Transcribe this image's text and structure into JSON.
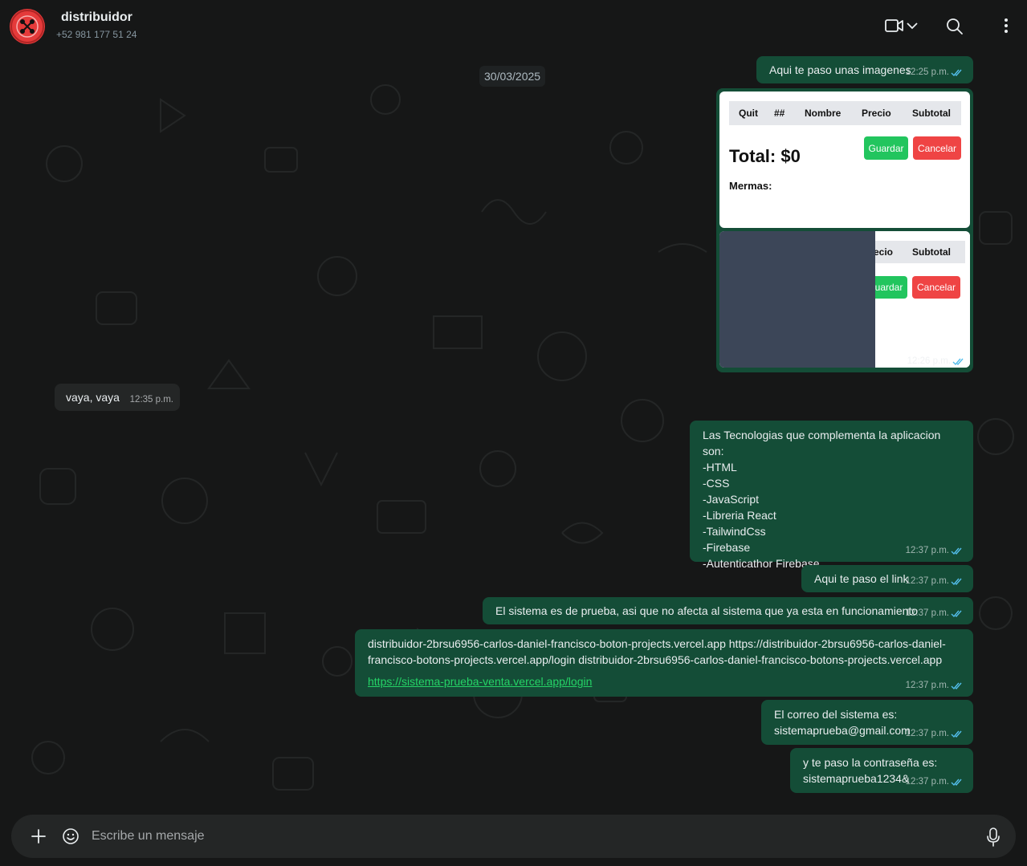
{
  "header": {
    "contact_name": "distribuidor",
    "contact_phone": "+52 981 177 51 24"
  },
  "chat": {
    "date_separator": "30/03/2025",
    "messages": [
      {
        "id": "m1",
        "direction": "out",
        "text": "Aqui te paso unas imagenes",
        "time": "12:25 p.m."
      },
      {
        "id": "m2",
        "direction": "out",
        "type": "images",
        "time": "12:26 p.m.",
        "image1": {
          "headers": [
            "Quit",
            "##",
            "Nombre",
            "Precio",
            "Subtotal"
          ],
          "total": "Total: $0",
          "mermas": "Mermas:",
          "save_button": "Guardar",
          "cancel_button": "Cancelar"
        },
        "image2": {
          "headers": [
            "ecio",
            "Subtotal"
          ],
          "save_button": "uardar",
          "cancel_button": "Cancelar"
        }
      },
      {
        "id": "m3",
        "direction": "in",
        "text": "vaya, vaya",
        "time": "12:35 p.m."
      },
      {
        "id": "m4",
        "direction": "out",
        "text": "Las Tecnologias que complementa la aplicacion son:\n-HTML\n-CSS\n-JavaScript\n-Libreria React\n-TailwindCss\n-Firebase\n-Autenticathor Firebase",
        "time": "12:37 p.m."
      },
      {
        "id": "m5",
        "direction": "out",
        "text": "Aqui te paso el link",
        "time": "12:37 p.m."
      },
      {
        "id": "m6",
        "direction": "out",
        "text": "El sistema es de prueba, asi que no afecta al sistema que ya esta en funcionamiento",
        "time": "12:37 p.m."
      },
      {
        "id": "m7",
        "direction": "out",
        "text": "distribuidor-2brsu6956-carlos-daniel-francisco-boton-projects.vercel.app https://distribuidor-2brsu6956-carlos-daniel-francisco-botons-projects.vercel.app/login distribuidor-2brsu6956-carlos-daniel-francisco-botons-projects.vercel.app",
        "link": "https://sistema-prueba-venta.vercel.app/login",
        "time": "12:37 p.m."
      },
      {
        "id": "m8",
        "direction": "out",
        "text": "El correo del sistema es:\nsistemaprueba@gmail.com",
        "time": "12:37 p.m."
      },
      {
        "id": "m9",
        "direction": "out",
        "text": "y te paso la contraseña es:\nsistemaprueba1234&",
        "time": "12:37 p.m."
      }
    ]
  },
  "composer": {
    "placeholder": "Escribe un mensaje"
  },
  "icons": {
    "video_call": "video-camera-icon",
    "dropdown": "chevron-down-icon",
    "search": "search-icon",
    "menu": "kebab-menu-icon",
    "attach": "plus-icon",
    "emoji": "emoji-icon",
    "mic": "microphone-icon"
  },
  "colors": {
    "outgoing_bubble": "#144d37",
    "incoming_bubble": "#242626",
    "background": "#161717",
    "read_ticks": "#53bdeb",
    "link": "#25d366"
  }
}
